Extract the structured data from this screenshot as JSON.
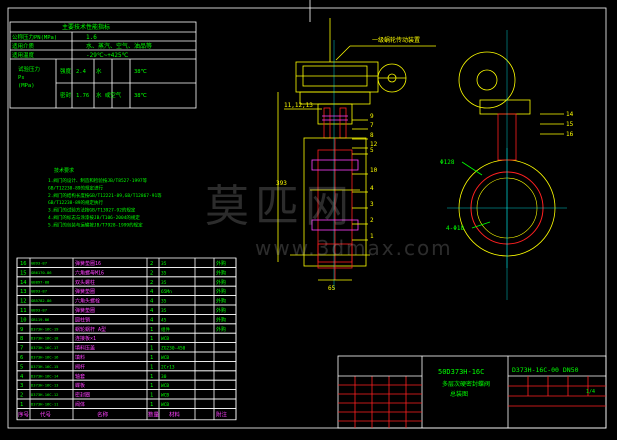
{
  "colors": {
    "background": "#000000",
    "frame": "#ffffff",
    "line": "#ffff00",
    "green": "#00ff00",
    "red": "#ff2020",
    "magenta": "#ff40ff",
    "cyan": "#00ffff",
    "blue": "#4040ff"
  },
  "spec_table": {
    "title": "主要技术性能指标",
    "rows": [
      {
        "label": "公称压力PN(MPa)",
        "value": "1.6"
      },
      {
        "label": "适用介质",
        "value": "水、蒸汽、空气、油品等"
      },
      {
        "label": "适用温度",
        "value": "-29℃~+425℃"
      }
    ],
    "test": {
      "label_lines": [
        "试验压力",
        "Ps",
        "(MPa)"
      ],
      "r1": {
        "kind": "强度",
        "value": "2.4",
        "medium": "水",
        "temp": "38℃"
      },
      "r2": {
        "kind": "密封",
        "value": "1.76",
        "medium": "水 或空气",
        "temp": "38℃"
      }
    }
  },
  "notes": {
    "title": "技术要求",
    "lines": [
      "1.阀门的设计、制造和检验按JB/T8527-1997等",
      "GB/T12238-89的规定进行",
      "2.阀门的结构长度按GB/T12221-89,GB/T12867-91等",
      "GB/T12238-89的规定执行",
      "3.阀门的试验方法按GB/T13927-92的规定",
      "4.阀门的标志与涂漆按JB/T106-2004的规定",
      "5.阀门的包装与运输按JB/T7928-1999的规定"
    ]
  },
  "parts_table": {
    "header": {
      "no": "序号",
      "code": "代号",
      "name": "名称",
      "qty": "数量",
      "material": "材料",
      "note": "附注"
    },
    "rows": [
      {
        "no": "16",
        "code": "GB93-87",
        "name": "弹簧垫圈16",
        "qty": "2",
        "material": "35",
        "note": "外购"
      },
      {
        "no": "15",
        "code": "GB6170-86",
        "name": "六角螺母M16",
        "qty": "2",
        "material": "35",
        "note": "外购"
      },
      {
        "no": "14",
        "code": "GB897-88",
        "name": "双头螺柱",
        "qty": "2",
        "material": "35",
        "note": "外购"
      },
      {
        "no": "13",
        "code": "GB93-87",
        "name": "弹簧垫圈",
        "qty": "4",
        "material": "65Mn",
        "note": "外购"
      },
      {
        "no": "12",
        "code": "GB5782-86",
        "name": "六角头螺栓",
        "qty": "4",
        "material": "35",
        "note": "外购"
      },
      {
        "no": "11",
        "code": "GB93-87",
        "name": "弹簧垫圈",
        "qty": "4",
        "material": "35",
        "note": "外购"
      },
      {
        "no": "10",
        "code": "GB119-86",
        "name": "圆柱销",
        "qty": "4",
        "material": "45",
        "note": "外购"
      },
      {
        "no": "9",
        "code": "D373H-16C-19",
        "name": "蜗轮蜗杆 A型",
        "qty": "1",
        "material": "组件",
        "note": "外购"
      },
      {
        "no": "8",
        "code": "D373H-16C-18",
        "name": "连接板×1",
        "qty": "1",
        "material": "WCB",
        "note": ""
      },
      {
        "no": "7",
        "code": "D373H-16C-17",
        "name": "填料压盖",
        "qty": "1",
        "material": "ZG230-450",
        "note": ""
      },
      {
        "no": "6",
        "code": "D373H-16C-16",
        "name": "填料",
        "qty": "1",
        "material": "WCB",
        "note": ""
      },
      {
        "no": "5",
        "code": "D373H-16C-15",
        "name": "阀杆",
        "qty": "1",
        "material": "2Cr13",
        "note": ""
      },
      {
        "no": "4",
        "code": "D373H-16C-14",
        "name": "轴套",
        "qty": "1",
        "material": "30",
        "note": ""
      },
      {
        "no": "3",
        "code": "D373H-16C-13",
        "name": "蝶板",
        "qty": "1",
        "material": "WCB",
        "note": ""
      },
      {
        "no": "2",
        "code": "D373H-16C-12",
        "name": "密封圈",
        "qty": "1",
        "material": "WCB",
        "note": ""
      },
      {
        "no": "1",
        "code": "D373H-16C-11",
        "name": "阀体",
        "qty": "1",
        "material": "WCB",
        "note": ""
      }
    ]
  },
  "drawing": {
    "operator_label": "一级蜗轮传动装置",
    "callouts_left": [
      "11,12,13",
      "9",
      "8",
      "7",
      "12",
      "5",
      "10",
      "4",
      "3",
      "2",
      "1"
    ],
    "callouts_right": [
      "14",
      "15",
      "16"
    ],
    "dim_phi": "Φ128",
    "dim_bolts": "4-Φ18",
    "dim_height": "393",
    "dim_width": "65"
  },
  "title_block": {
    "model": "50D373H-16C",
    "name_l1": "多层次硬密封蝶阀",
    "name_l2": "总装图",
    "drawing_no": "D373H-16C-00 DN50",
    "sheet": "1/4"
  },
  "watermark": {
    "text": "莫匹网",
    "url": "www.3dmax.com"
  }
}
